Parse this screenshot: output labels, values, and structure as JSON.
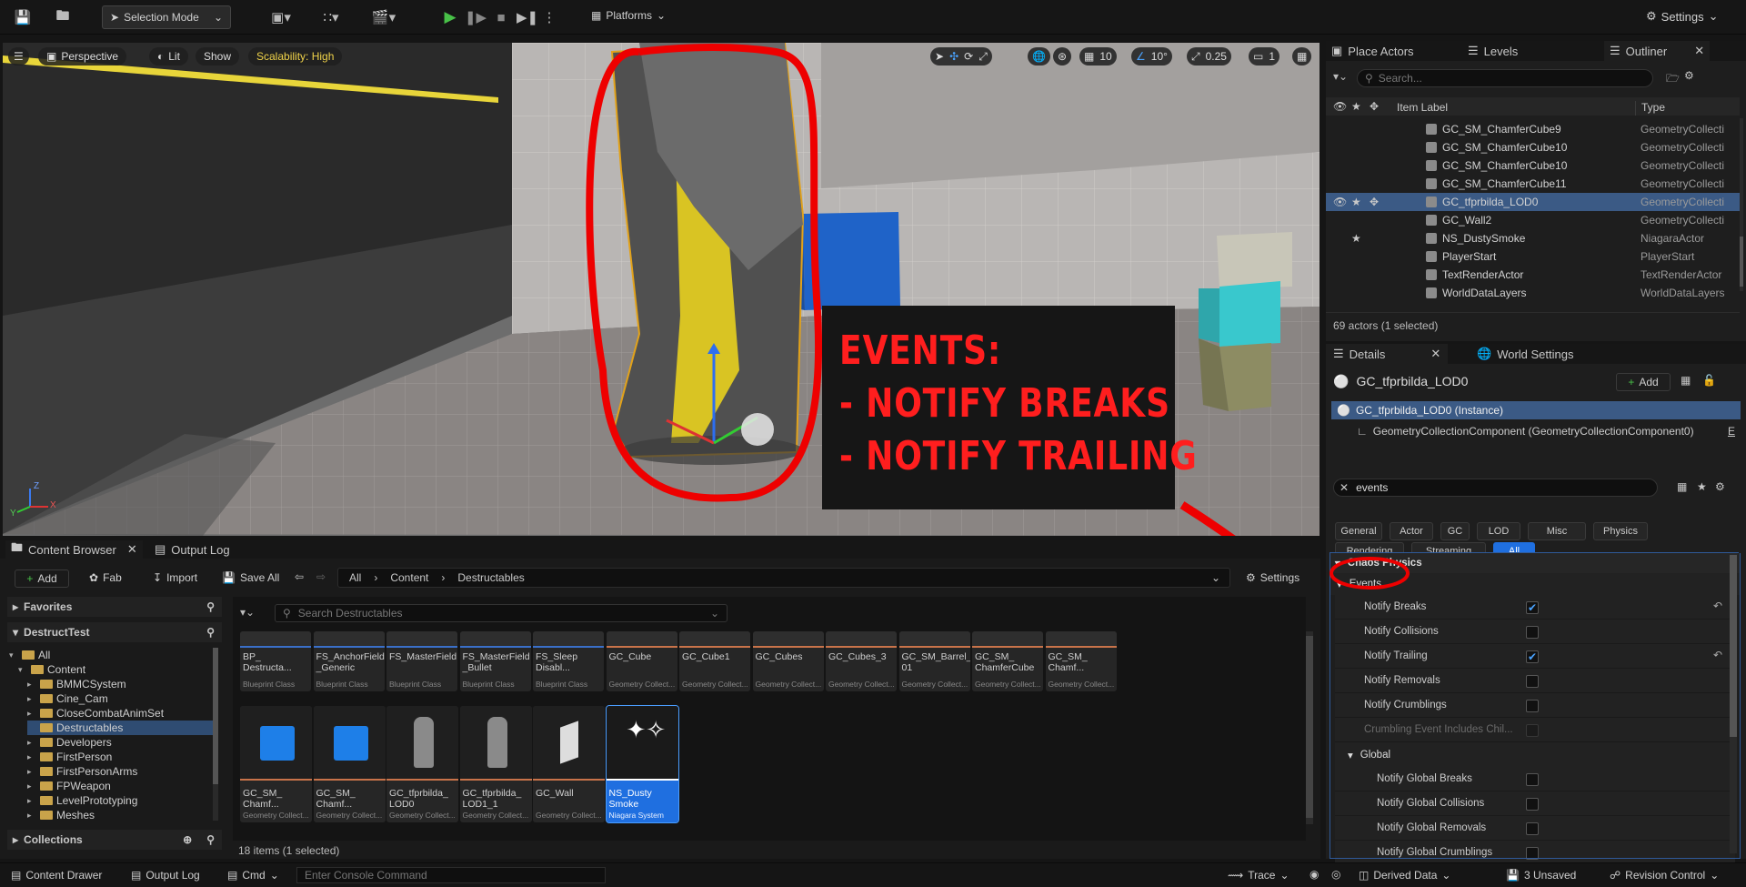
{
  "toolbar": {
    "selection_mode": "Selection Mode",
    "platforms": "Platforms",
    "settings": "Settings"
  },
  "viewport": {
    "perspective": "Perspective",
    "lit": "Lit",
    "show": "Show",
    "scalability": "Scalability: High",
    "grid": "10",
    "angle": "10°",
    "scale": "0.25",
    "camera_speed": "1",
    "annotation": {
      "line1": "EVENTS:",
      "line2": "- NOTIFY BREAKS",
      "line3": "- NOTIFY TRAILING"
    },
    "axis": {
      "z": "Z",
      "x": "X",
      "y": "Y"
    }
  },
  "outliner": {
    "tabs": [
      "Place Actors",
      "Levels",
      "Outliner"
    ],
    "search_placeholder": "Search...",
    "col_label": "Item Label",
    "col_type": "Type",
    "rows": [
      {
        "name": "GC_SM_ChamferCube9",
        "type": "GeometryCollecti"
      },
      {
        "name": "GC_SM_ChamferCube10",
        "type": "GeometryCollecti"
      },
      {
        "name": "GC_SM_ChamferCube10",
        "type": "GeometryCollecti"
      },
      {
        "name": "GC_SM_ChamferCube11",
        "type": "GeometryCollecti"
      },
      {
        "name": "GC_tfprbilda_LOD0",
        "type": "GeometryCollecti"
      },
      {
        "name": "GC_Wall2",
        "type": "GeometryCollecti"
      },
      {
        "name": "NS_DustySmoke",
        "type": "NiagaraActor"
      },
      {
        "name": "PlayerStart",
        "type": "PlayerStart"
      },
      {
        "name": "TextRenderActor",
        "type": "TextRenderActor"
      },
      {
        "name": "WorldDataLayers",
        "type": "WorldDataLayers"
      }
    ],
    "footer": "69 actors (1 selected)"
  },
  "details": {
    "tabs": [
      "Details",
      "World Settings"
    ],
    "actor_name": "GC_tfprbilda_LOD0",
    "add": "Add",
    "instance": "GC_tfprbilda_LOD0 (Instance)",
    "component": "GeometryCollectionComponent (GeometryCollectionComponent0)",
    "component_suffix": "E",
    "search_value": "events",
    "filters": [
      "General",
      "Actor",
      "GC",
      "LOD",
      "Misc",
      "Physics",
      "Rendering",
      "Streaming",
      "All"
    ],
    "section": "Chaos Physics",
    "subsection": "Events",
    "global": "Global",
    "props": [
      {
        "label": "Notify Breaks",
        "checked": true
      },
      {
        "label": "Notify Collisions",
        "checked": false
      },
      {
        "label": "Notify Trailing",
        "checked": true
      },
      {
        "label": "Notify Removals",
        "checked": false
      },
      {
        "label": "Notify Crumblings",
        "checked": false
      },
      {
        "label": "Crumbling Event Includes Chil...",
        "checked": false
      }
    ],
    "global_props": [
      {
        "label": "Notify Global Breaks",
        "checked": false
      },
      {
        "label": "Notify Global Collisions",
        "checked": false
      },
      {
        "label": "Notify Global Removals",
        "checked": false
      },
      {
        "label": "Notify Global Crumblings",
        "checked": false
      }
    ]
  },
  "content_browser": {
    "tabs": [
      "Content Browser",
      "Output Log"
    ],
    "add": "Add",
    "fab": "Fab",
    "import": "Import",
    "save_all": "Save All",
    "path": [
      "All",
      "Content",
      "Destructables"
    ],
    "settings": "Settings",
    "favorites": "Favorites",
    "project": "DestructTest",
    "collections": "Collections",
    "search_placeholder": "Search Destructables",
    "tree": [
      "All",
      "Content",
      "BMMCSystem",
      "Cine_Cam",
      "CloseCombatAnimSet",
      "Destructables",
      "Developers",
      "FirstPerson",
      "FirstPersonArms",
      "FPWeapon",
      "LevelPrototyping",
      "Meshes"
    ],
    "row1": [
      {
        "name": "BP_\nDestructa...",
        "type": "Blueprint Class"
      },
      {
        "name": "FS_AnchorField\n_Generic",
        "type": "Blueprint Class"
      },
      {
        "name": "FS_MasterField",
        "type": "Blueprint Class"
      },
      {
        "name": "FS_MasterField\n_Bullet",
        "type": "Blueprint Class"
      },
      {
        "name": "FS_Sleep\nDisabl...",
        "type": "Blueprint Class"
      },
      {
        "name": "GC_Cube",
        "type": "Geometry Collect..."
      },
      {
        "name": "GC_Cube1",
        "type": "Geometry Collect..."
      },
      {
        "name": "GC_Cubes",
        "type": "Geometry Collect..."
      },
      {
        "name": "GC_Cubes_3",
        "type": "Geometry Collect..."
      },
      {
        "name": "GC_SM_Barrel_\n01",
        "type": "Geometry Collect..."
      },
      {
        "name": "GC_SM_\nChamferCube",
        "type": "Geometry Collect..."
      },
      {
        "name": "GC_SM_\nChamf...",
        "type": "Geometry Collect..."
      }
    ],
    "row2": [
      {
        "name": "GC_SM_\nChamf...",
        "type": "Geometry Collect..."
      },
      {
        "name": "GC_SM_\nChamf...",
        "type": "Geometry Collect..."
      },
      {
        "name": "GC_tfprbilda_\nLOD0",
        "type": "Geometry Collect..."
      },
      {
        "name": "GC_tfprbilda_\nLOD1_1",
        "type": "Geometry Collect..."
      },
      {
        "name": "GC_Wall",
        "type": "Geometry Collect..."
      },
      {
        "name": "NS_Dusty\nSmoke",
        "type": "Niagara System"
      }
    ],
    "footer": "18 items (1 selected)"
  },
  "status": {
    "content_drawer": "Content Drawer",
    "output_log": "Output Log",
    "cmd": "Cmd",
    "console_placeholder": "Enter Console Command",
    "trace": "Trace",
    "derived_data": "Derived Data",
    "unsaved": "3 Unsaved",
    "revision": "Revision Control"
  }
}
